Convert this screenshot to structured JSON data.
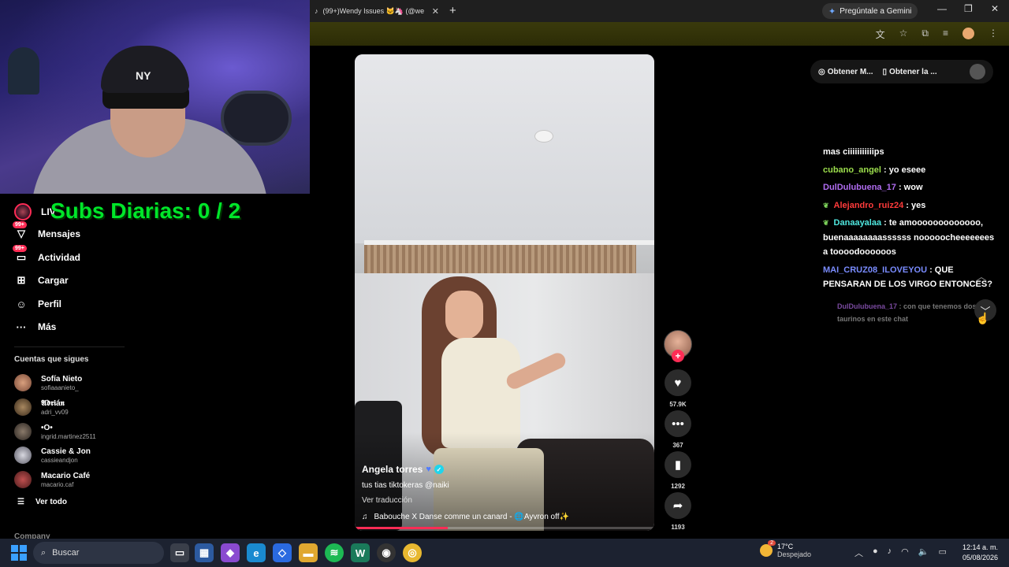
{
  "browser": {
    "tab_title": "(99+)Wendy Issues 🐱🦄 (@we",
    "gemini_button": "Pregúntale a Gemini"
  },
  "overlay": {
    "subs_text": "Subs Diarias: 0 / 2"
  },
  "sidebar": {
    "live_label": "LIV",
    "items": [
      {
        "label": "Mensajes",
        "badge": "99+"
      },
      {
        "label": "Actividad",
        "badge": "99+"
      },
      {
        "label": "Cargar"
      },
      {
        "label": "Perfil"
      },
      {
        "label": "Más"
      }
    ],
    "following_title": "Cuentas que sigues",
    "following": [
      {
        "name": "Sofía Nieto",
        "handle": "sofiaaanieto_"
      },
      {
        "name": "𝕬𝖉𝖗𝖎á𝖓",
        "handle": "adri_vv09"
      },
      {
        "name": "•O•",
        "handle": "ingrid.martinez2511"
      },
      {
        "name": "Cassie & Jon",
        "handle": "cassieandjon"
      },
      {
        "name": "Macario Café",
        "handle": "macario.caf"
      }
    ],
    "see_all": "Ver todo",
    "company": "Company"
  },
  "video": {
    "author": "Angela torres",
    "description": "tus tias tiktokeras @naiki",
    "translate": "Ver traducción",
    "music": "Babouche X Danse comme un canard - 🌐Ayvron off✨",
    "progress": 0.31
  },
  "actions": {
    "likes": "57.9K",
    "comments": "367",
    "saves": "1292",
    "shares": "1193"
  },
  "chat_panel": {
    "get_btn1": "Obtener M...",
    "get_btn2": "Obtener la ...",
    "messages": [
      {
        "user": "",
        "text": "mas ciiiiiiiiiiips"
      },
      {
        "user": "cubano_angel",
        "text": " : yo eseee"
      },
      {
        "user": "DulDulubuena_17",
        "text": " : wow"
      },
      {
        "user": "Alejandro_ruiz24",
        "text": " : yes"
      },
      {
        "user": "Danaayalaa",
        "text": " : te amooooooooooooo, buenaaaaaaaassssss nooooocheeeeeees a toooodoooooos"
      },
      {
        "user": "MAI_CRUZ08_ILOVEYOU",
        "text": " : QUE PENSARAN DE LOS VIRGO ENTONCES?"
      }
    ],
    "faded_user": "DulDulubuena_17",
    "faded_text": " : con que tenemos dos taurinos en este chat"
  },
  "taskbar": {
    "search": "Buscar",
    "temp": "17°C",
    "weather": "Despejado",
    "weather_badge": "2",
    "time": "12:14 a. m.",
    "date": "05/08/2026"
  }
}
